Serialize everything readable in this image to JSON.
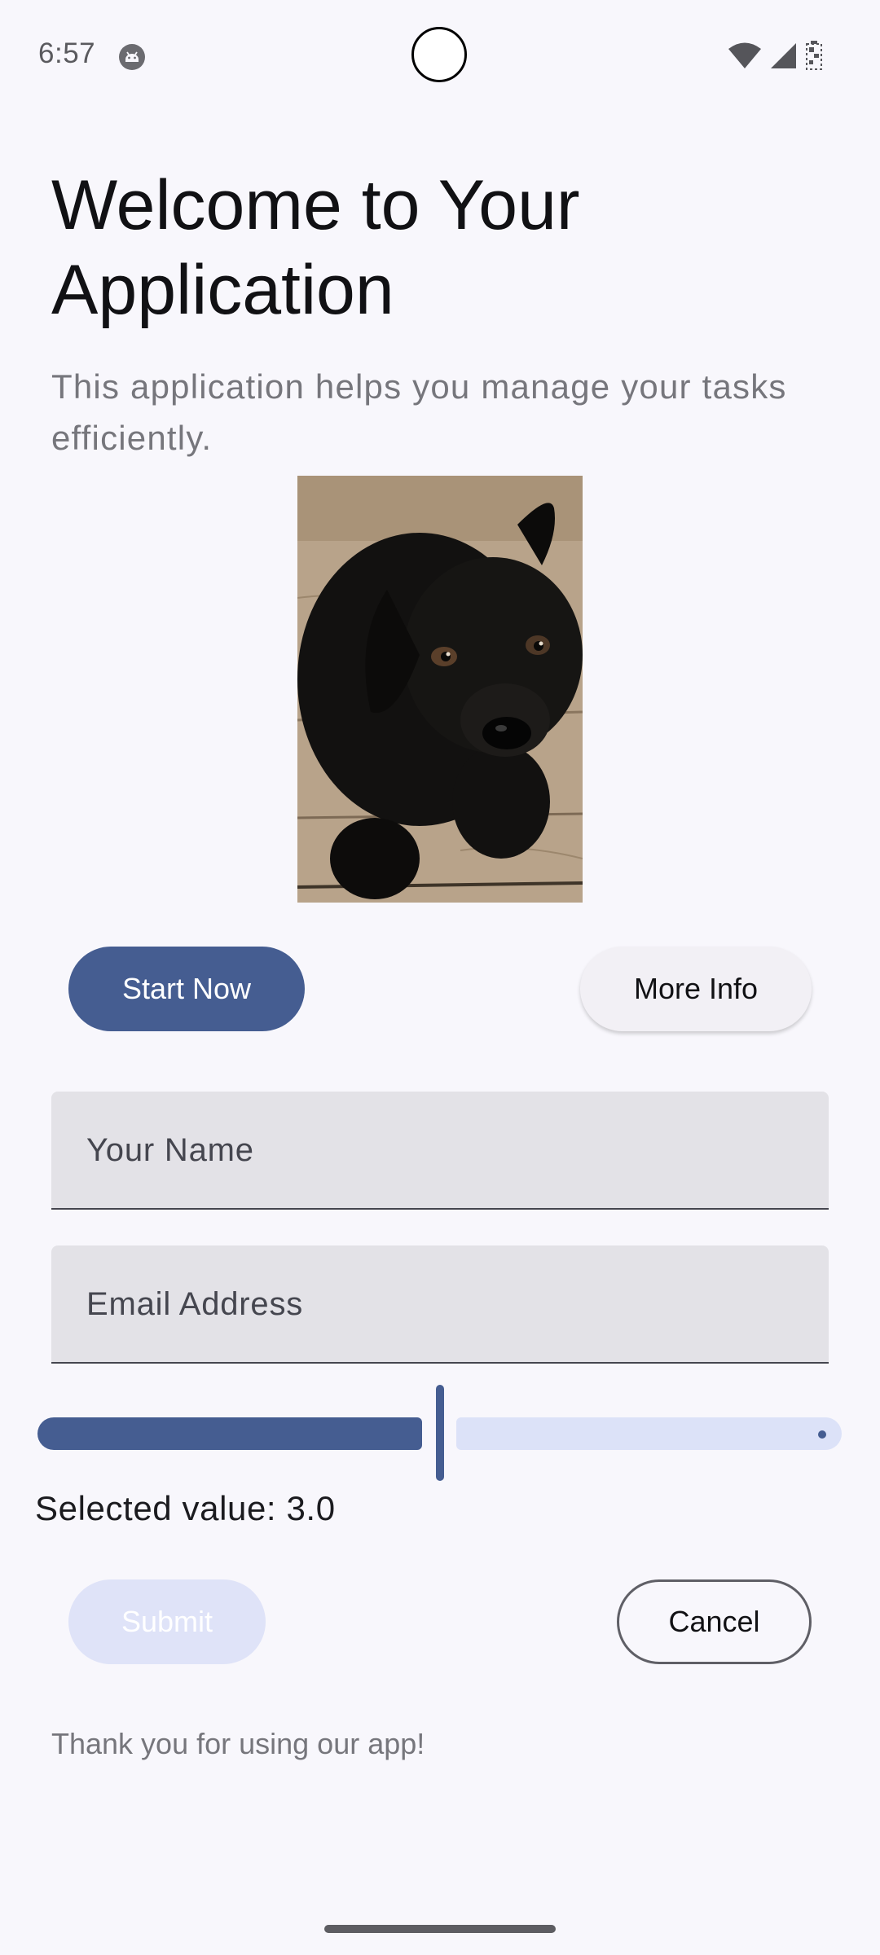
{
  "status_bar": {
    "time": "6:57",
    "app_icon": "android-robot-icon",
    "icons": [
      "wifi-icon",
      "cellular-signal-icon",
      "battery-icon"
    ]
  },
  "header": {
    "title": "Welcome to Your Application",
    "subtitle": "This application helps you manage your tasks efficiently."
  },
  "image": {
    "subject": "black-puppy-photo"
  },
  "actions": {
    "start_label": "Start Now",
    "more_label": "More Info"
  },
  "form": {
    "name_placeholder": "Your Name",
    "name_value": "",
    "email_placeholder": "Email Address",
    "email_value": ""
  },
  "slider": {
    "min": 0,
    "max": 6,
    "value": 3.0,
    "label": "Selected value: 3.0"
  },
  "form_actions": {
    "submit_label": "Submit",
    "submit_enabled": false,
    "cancel_label": "Cancel"
  },
  "footer": {
    "text": "Thank you for using our app!"
  },
  "colors": {
    "primary": "#455d91",
    "background": "#f8f7fc",
    "field_background": "#e3e2e7",
    "disabled_button": "#dfe3f8",
    "slider_inactive": "#dce2f8"
  }
}
